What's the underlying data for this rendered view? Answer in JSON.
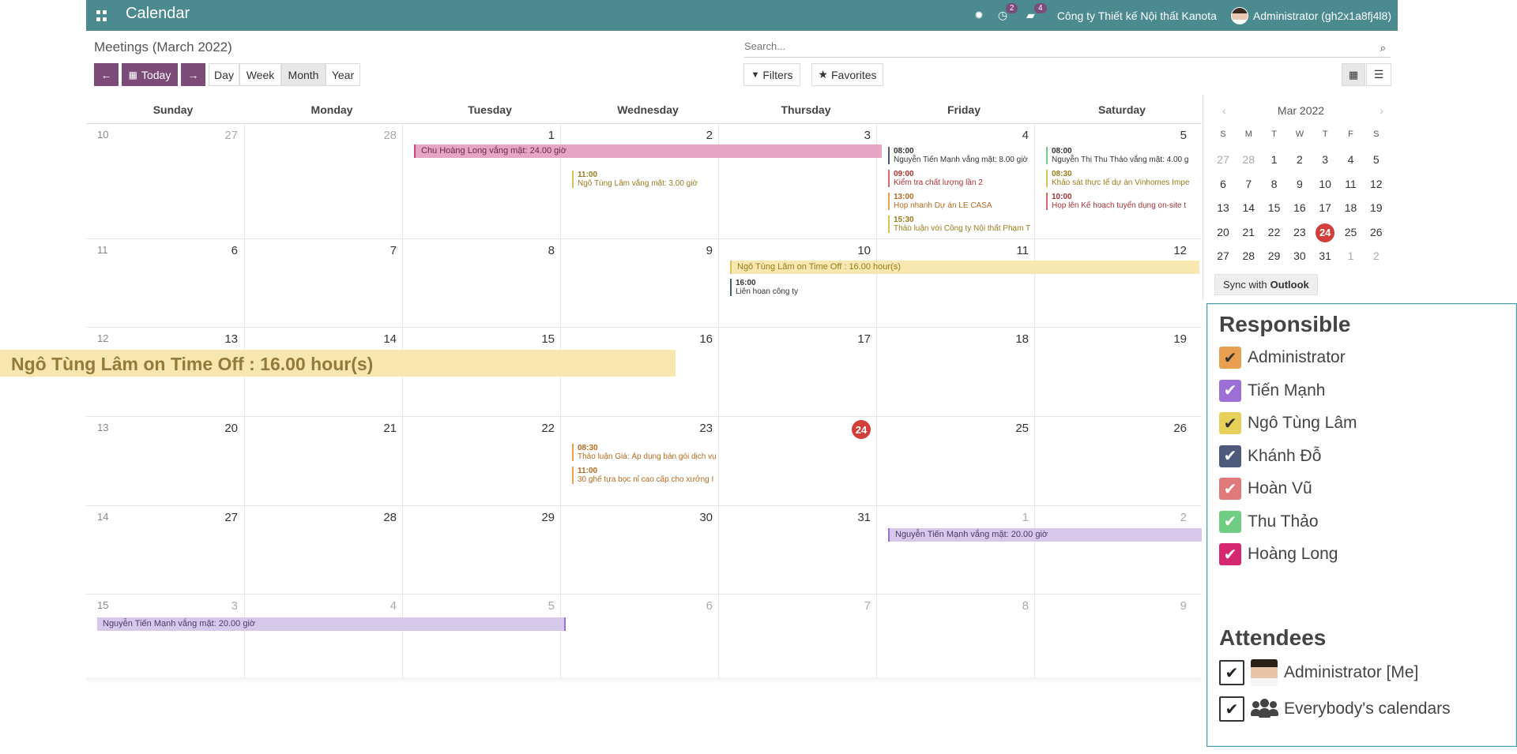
{
  "navbar": {
    "title": "Calendar",
    "activity_count": "2",
    "messages_count": "4",
    "company": "Công ty Thiết kế Nội thất Kanota",
    "user": "Administrator (gh2x1a8fj4l8)"
  },
  "control": {
    "page_title": "Meetings (March 2022)",
    "search_placeholder": "Search...",
    "today_label": "Today",
    "day_label": "Day",
    "week_label": "Week",
    "month_label": "Month",
    "year_label": "Year",
    "filters_label": "Filters",
    "favorites_label": "Favorites"
  },
  "calendar": {
    "weekdays": [
      "Sunday",
      "Monday",
      "Tuesday",
      "Wednesday",
      "Thursday",
      "Friday",
      "Saturday"
    ],
    "weeks": [
      {
        "num": "10",
        "days": [
          "27",
          "28",
          "1",
          "2",
          "3",
          "4",
          "5"
        ]
      },
      {
        "num": "11",
        "days": [
          "6",
          "7",
          "8",
          "9",
          "10",
          "11",
          "12"
        ]
      },
      {
        "num": "12",
        "days": [
          "13",
          "14",
          "15",
          "16",
          "17",
          "18",
          "19"
        ]
      },
      {
        "num": "13",
        "days": [
          "20",
          "21",
          "22",
          "23",
          "24",
          "25",
          "26"
        ]
      },
      {
        "num": "14",
        "days": [
          "27",
          "28",
          "29",
          "30",
          "31",
          "1",
          "2"
        ]
      },
      {
        "num": "15",
        "days": [
          "3",
          "4",
          "5",
          "6",
          "7",
          "8",
          "9"
        ]
      }
    ],
    "bars": {
      "chu_hoang_long": "Chu Hoàng Long vắng mặt: 24.00 giờ",
      "ngo_tung_lam_w2": "Ngô Tùng Lâm on Time Off : 16.00 hour(s)",
      "nguyen_tien_manh_w5": "Nguyễn Tiến Mạnh vắng mặt: 20.00 giờ",
      "nguyen_tien_manh_w6": "Nguyễn Tiến Mạnh vắng mặt: 20.00 giờ"
    },
    "events": {
      "wed2": {
        "time": "11:00",
        "title": "Ngô Tùng Lâm vắng mặt: 3.00 giờ"
      },
      "fri4_1": {
        "time": "08:00",
        "title": "Nguyễn Tiến Mạnh vắng mặt: 8.00 giờ"
      },
      "fri4_2": {
        "time": "09:00",
        "title": "Kiểm tra chất lượng lần 2"
      },
      "fri4_3": {
        "time": "13:00",
        "title": "Họp nhanh Dự án LE CASA"
      },
      "fri4_4": {
        "time": "15:30",
        "title": "Thảo luận với Công ty Nội thất Phạm T"
      },
      "sat5_1": {
        "time": "08:00",
        "title": "Nguyễn Thị Thu Thảo vắng mặt: 4.00 g"
      },
      "sat5_2": {
        "time": "08:30",
        "title": "Khảo sát thực tế dự án Vinhomes Impe"
      },
      "sat5_3": {
        "time": "10:00",
        "title": "Họp lên Kế hoạch tuyển dụng on-site t"
      },
      "thu10": {
        "time": "16:00",
        "title": "Liên hoan công ty"
      },
      "wed23_1": {
        "time": "08:30",
        "title": "Thảo luận Giá: Áp dụng bán gói dịch vụ"
      },
      "wed23_2": {
        "time": "11:00",
        "title": "30 ghế tựa bọc nỉ cao cấp cho xưởng I"
      }
    },
    "zoom_event": "Ngô Tùng Lâm on Time Off : 16.00 hour(s)"
  },
  "mini_calendar": {
    "title": "Mar 2022",
    "dow": [
      "S",
      "M",
      "T",
      "W",
      "T",
      "F",
      "S"
    ],
    "weeks": [
      [
        "27",
        "28",
        "1",
        "2",
        "3",
        "4",
        "5"
      ],
      [
        "6",
        "7",
        "8",
        "9",
        "10",
        "11",
        "12"
      ],
      [
        "13",
        "14",
        "15",
        "16",
        "17",
        "18",
        "19"
      ],
      [
        "20",
        "21",
        "22",
        "23",
        "24",
        "25",
        "26"
      ],
      [
        "27",
        "28",
        "29",
        "30",
        "31",
        "1",
        "2"
      ]
    ],
    "sync_prefix": "Sync with",
    "sync_service": "Outlook"
  },
  "filters": {
    "responsible_title": "Responsible",
    "responsible": [
      {
        "name": "Administrator",
        "color": "#e8a050"
      },
      {
        "name": "Tiến Mạnh",
        "color": "#9c6fd6"
      },
      {
        "name": "Ngô Tùng Lâm",
        "color": "#e6d05a"
      },
      {
        "name": "Khánh Đỗ",
        "color": "#4e5a7c"
      },
      {
        "name": "Hoàn Vũ",
        "color": "#e07a7a"
      },
      {
        "name": "Thu Thảo",
        "color": "#6fce83"
      },
      {
        "name": "Hoàng Long",
        "color": "#d62870"
      }
    ],
    "attendees_title": "Attendees",
    "attendees": [
      {
        "name": "Administrator [Me]"
      },
      {
        "name": "Everybody's calendars"
      }
    ]
  }
}
